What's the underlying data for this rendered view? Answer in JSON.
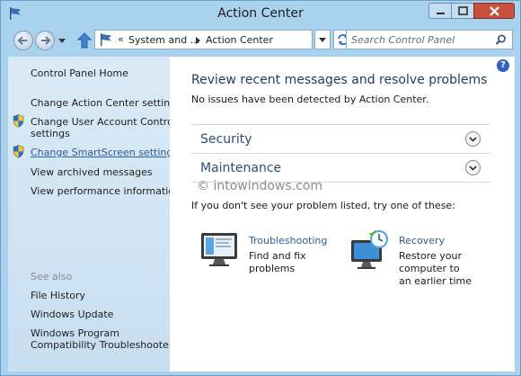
{
  "window": {
    "title": "Action Center"
  },
  "address_bar": {
    "prefix": "«",
    "crumb1": "System and ...",
    "crumb2": "Action Center"
  },
  "search": {
    "placeholder": "Search Control Panel"
  },
  "sidebar": {
    "home": "Control Panel Home",
    "links": [
      "Change Action Center settings",
      "Change User Account Control",
      "settings",
      "Change SmartScreen settings",
      "View archived messages",
      "View performance information"
    ],
    "see_also_heading": "See also",
    "see_also": [
      "File History",
      "Windows Update",
      "Windows Program",
      "Compatibility Troubleshooter"
    ]
  },
  "main": {
    "title": "Review recent messages and resolve problems",
    "status": "No issues have been detected by Action Center.",
    "sections": [
      "Security",
      "Maintenance"
    ],
    "watermark": "© intowindows.com",
    "try_prompt": "If you don't see your problem listed, try one of these:",
    "help_glyph": "?"
  },
  "tools": [
    {
      "title": "Troubleshooting",
      "desc_lines": [
        "Find and fix",
        "problems"
      ],
      "icon": "troubleshooting-monitor-icon"
    },
    {
      "title": "Recovery",
      "desc_lines": [
        "Restore your",
        "computer to",
        "an earlier time"
      ],
      "icon": "recovery-computer-clock-icon"
    }
  ],
  "colors": {
    "chrome": "#a9d2ee",
    "link": "#2b5c9e",
    "section_heading": "#2b4e80",
    "close_button": "#c7503f"
  }
}
